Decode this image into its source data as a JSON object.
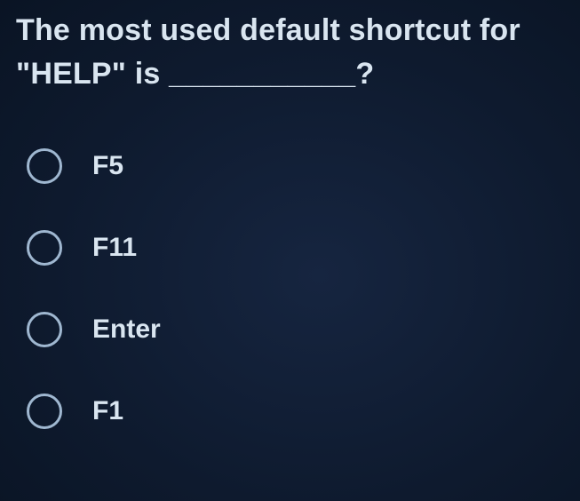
{
  "question": "The most used default shortcut for \"HELP\" is ___________?",
  "options": [
    {
      "label": "F5"
    },
    {
      "label": "F11"
    },
    {
      "label": "Enter"
    },
    {
      "label": "F1"
    }
  ]
}
